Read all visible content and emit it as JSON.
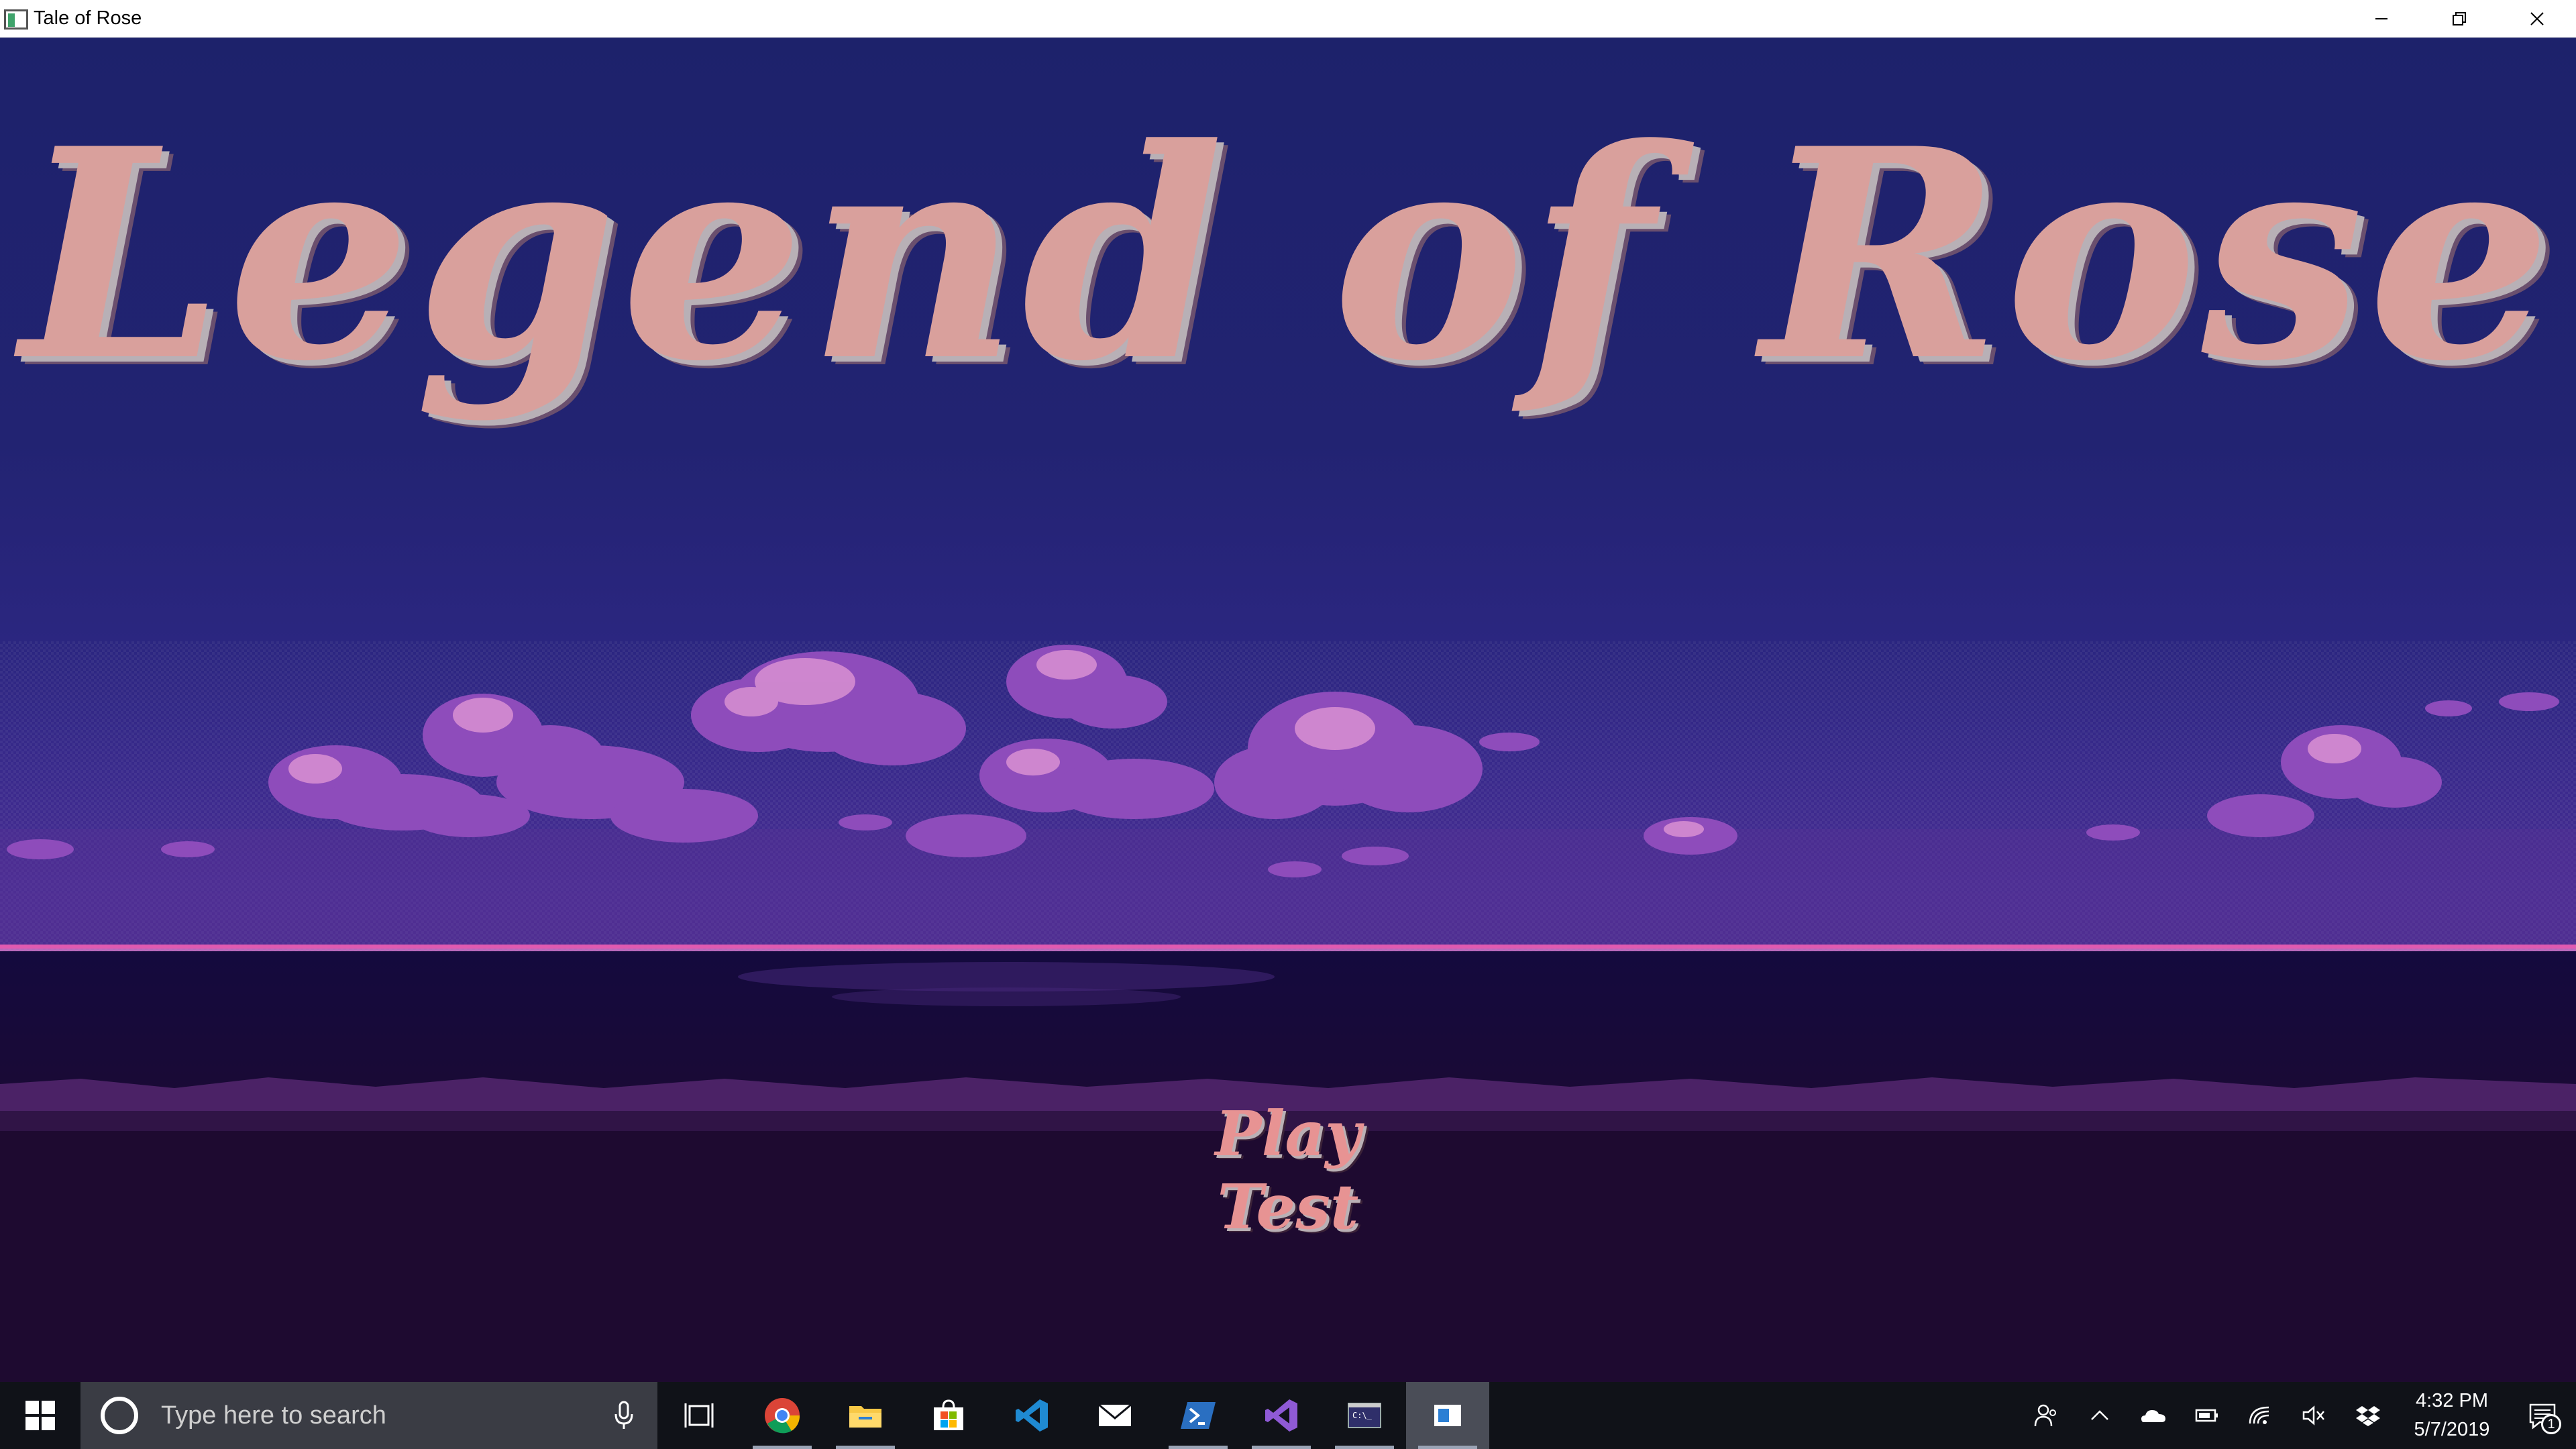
{
  "window": {
    "title": "Tale of Rose",
    "controls": [
      "minimize-icon",
      "restore-icon",
      "close-icon"
    ]
  },
  "game": {
    "title": "Legend of Rose",
    "menu": [
      {
        "label": "Play"
      },
      {
        "label": "Test"
      }
    ],
    "colors": {
      "sky_top": "#1d226b",
      "horizon_glow": "#e05ab0",
      "title_text": "#d9a09c",
      "menu_text": "#e79393",
      "clouds": "#a05ac8",
      "cloud_highlight": "#e39ad5",
      "ground": "#1e0a30"
    }
  },
  "taskbar": {
    "search_placeholder": "Type here to search",
    "apps": [
      {
        "icon": "task-view-icon"
      },
      {
        "icon": "chrome-icon"
      },
      {
        "icon": "file-explorer-icon"
      },
      {
        "icon": "microsoft-store-icon"
      },
      {
        "icon": "vscode-icon"
      },
      {
        "icon": "mail-icon"
      },
      {
        "icon": "powershell-icon"
      },
      {
        "icon": "visual-studio-icon"
      },
      {
        "icon": "terminal-icon"
      },
      {
        "icon": "game-window-icon"
      }
    ],
    "tray": [
      "people-icon",
      "chevron-up-icon",
      "onedrive-icon",
      "battery-icon",
      "wifi-icon",
      "volume-muted-icon",
      "dropbox-icon"
    ],
    "clock": {
      "time": "4:32 PM",
      "date": "5/7/2019"
    },
    "notification_count": "1"
  }
}
